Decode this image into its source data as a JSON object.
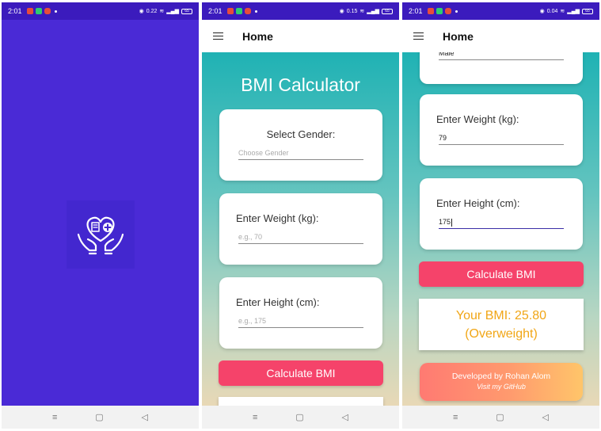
{
  "status": {
    "time": "2:01",
    "speed1": "0.22",
    "speed2": "0.15",
    "speed3": "0.04",
    "battery": "65"
  },
  "appbar": {
    "title": "Home"
  },
  "app": {
    "title": "BMI Calculator"
  },
  "gender": {
    "label": "Select Gender:",
    "placeholder": "Choose Gender",
    "value": "Male"
  },
  "weight": {
    "label": "Enter Weight (kg):",
    "placeholder": "e.g., 70",
    "value": "79"
  },
  "height": {
    "label": "Enter Height (cm):",
    "placeholder": "e.g., 175",
    "value": "175"
  },
  "button": {
    "label": "Calculate BMI"
  },
  "result": {
    "line1": "Your BMI: 25.80",
    "line2": "(Overweight)"
  },
  "credit": {
    "line1": "Developed by Rohan Alom",
    "line2": "Visit my GitHub"
  },
  "nav": {
    "recent": "≡",
    "home": "▢",
    "back": "◁"
  },
  "colors": {
    "splash": "#4a2ad6",
    "button": "#f5436a",
    "result_text": "#f1a616",
    "gradient_top": "#1fb2b4"
  }
}
